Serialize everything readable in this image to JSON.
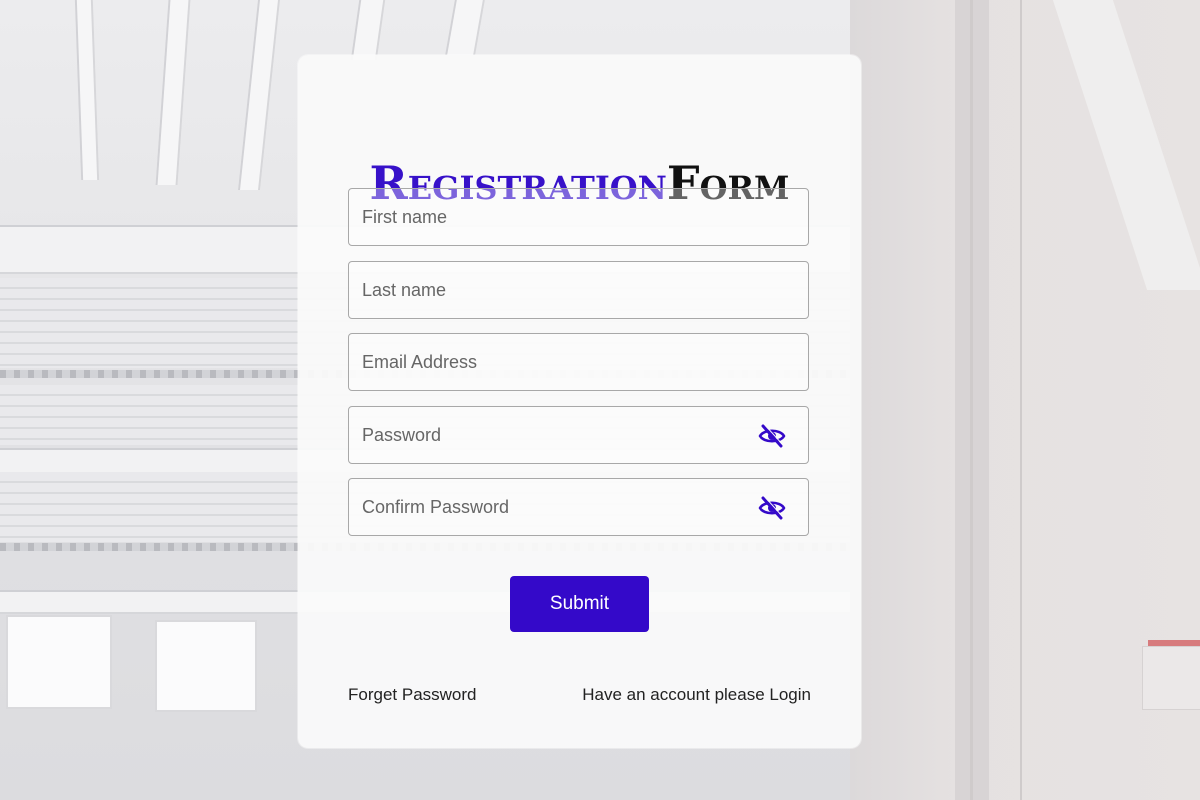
{
  "title": {
    "accent": "Registration",
    "main": "Form"
  },
  "fields": {
    "first_name": {
      "placeholder": "First name",
      "value": ""
    },
    "last_name": {
      "placeholder": "Last name",
      "value": ""
    },
    "email": {
      "placeholder": "Email Address",
      "value": ""
    },
    "password": {
      "placeholder": "Password",
      "value": "",
      "icon": "eye-slash-icon"
    },
    "confirm_password": {
      "placeholder": "Confirm Password",
      "value": "",
      "icon": "eye-slash-icon"
    }
  },
  "submit_label": "Submit",
  "links": {
    "forget_password": "Forget Password",
    "login": "Have an account please Login"
  },
  "colors": {
    "accent": "#3409c9",
    "title_accent": "#3711c9",
    "text": "#222222"
  }
}
